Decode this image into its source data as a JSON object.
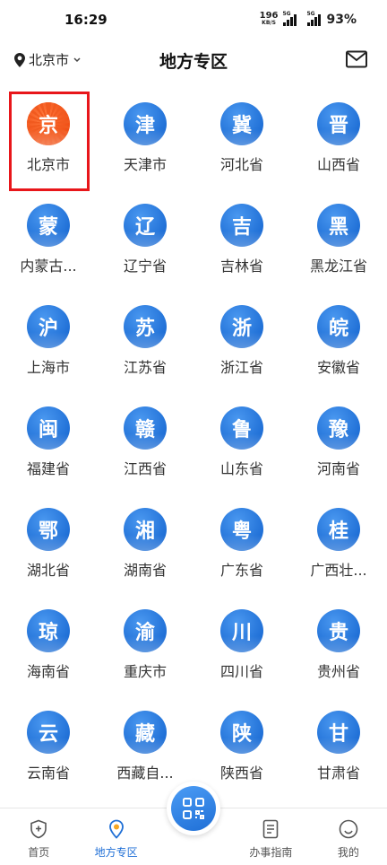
{
  "status": {
    "time": "16:29",
    "speed": "196",
    "speed_unit": "KB/S",
    "signal_1": "5G",
    "signal_2": "5G",
    "battery": "93%"
  },
  "header": {
    "city": "北京市",
    "title": "地方专区"
  },
  "regions": [
    {
      "char": "京",
      "name": "北京市",
      "selected": true
    },
    {
      "char": "津",
      "name": "天津市"
    },
    {
      "char": "冀",
      "name": "河北省"
    },
    {
      "char": "晋",
      "name": "山西省"
    },
    {
      "char": "蒙",
      "name": "内蒙古..."
    },
    {
      "char": "辽",
      "name": "辽宁省"
    },
    {
      "char": "吉",
      "name": "吉林省"
    },
    {
      "char": "黑",
      "name": "黑龙江省"
    },
    {
      "char": "沪",
      "name": "上海市"
    },
    {
      "char": "苏",
      "name": "江苏省"
    },
    {
      "char": "浙",
      "name": "浙江省"
    },
    {
      "char": "皖",
      "name": "安徽省"
    },
    {
      "char": "闽",
      "name": "福建省"
    },
    {
      "char": "赣",
      "name": "江西省"
    },
    {
      "char": "鲁",
      "name": "山东省"
    },
    {
      "char": "豫",
      "name": "河南省"
    },
    {
      "char": "鄂",
      "name": "湖北省"
    },
    {
      "char": "湘",
      "name": "湖南省"
    },
    {
      "char": "粤",
      "name": "广东省"
    },
    {
      "char": "桂",
      "name": "广西壮..."
    },
    {
      "char": "琼",
      "name": "海南省"
    },
    {
      "char": "渝",
      "name": "重庆市"
    },
    {
      "char": "川",
      "name": "四川省"
    },
    {
      "char": "贵",
      "name": "贵州省"
    },
    {
      "char": "云",
      "name": "云南省"
    },
    {
      "char": "藏",
      "name": "西藏自..."
    },
    {
      "char": "陕",
      "name": "陕西省"
    },
    {
      "char": "甘",
      "name": "甘肃省"
    }
  ],
  "tabs": {
    "home": "首页",
    "local": "地方专区",
    "guide": "办事指南",
    "mine": "我的"
  },
  "colors": {
    "accent": "#1f6fd6",
    "selected": "#f04e15",
    "highlight": "#e8161a"
  }
}
